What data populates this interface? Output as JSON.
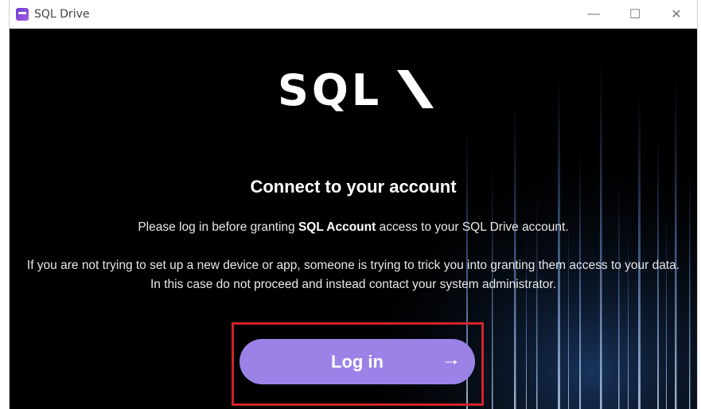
{
  "window": {
    "title": "SQL Drive",
    "icon": "sql-app-icon",
    "controls": {
      "minimize": "—",
      "maximize": "☐",
      "close": "✕"
    }
  },
  "main": {
    "logo_text": "SQL",
    "heading": "Connect to your account",
    "intro_before": "Please log in before granting ",
    "intro_bold": "SQL Account",
    "intro_after": " access to your SQL Drive account.",
    "warning": "If you are not trying to set up a new device or app, someone is trying to trick you into granting them access to your data. In this case do not proceed and instead contact your system administrator.",
    "login_label": "Log in",
    "login_arrow": "→"
  },
  "colors": {
    "background": "#000000",
    "button": "#9b82e6",
    "highlight": "#d1232a"
  }
}
